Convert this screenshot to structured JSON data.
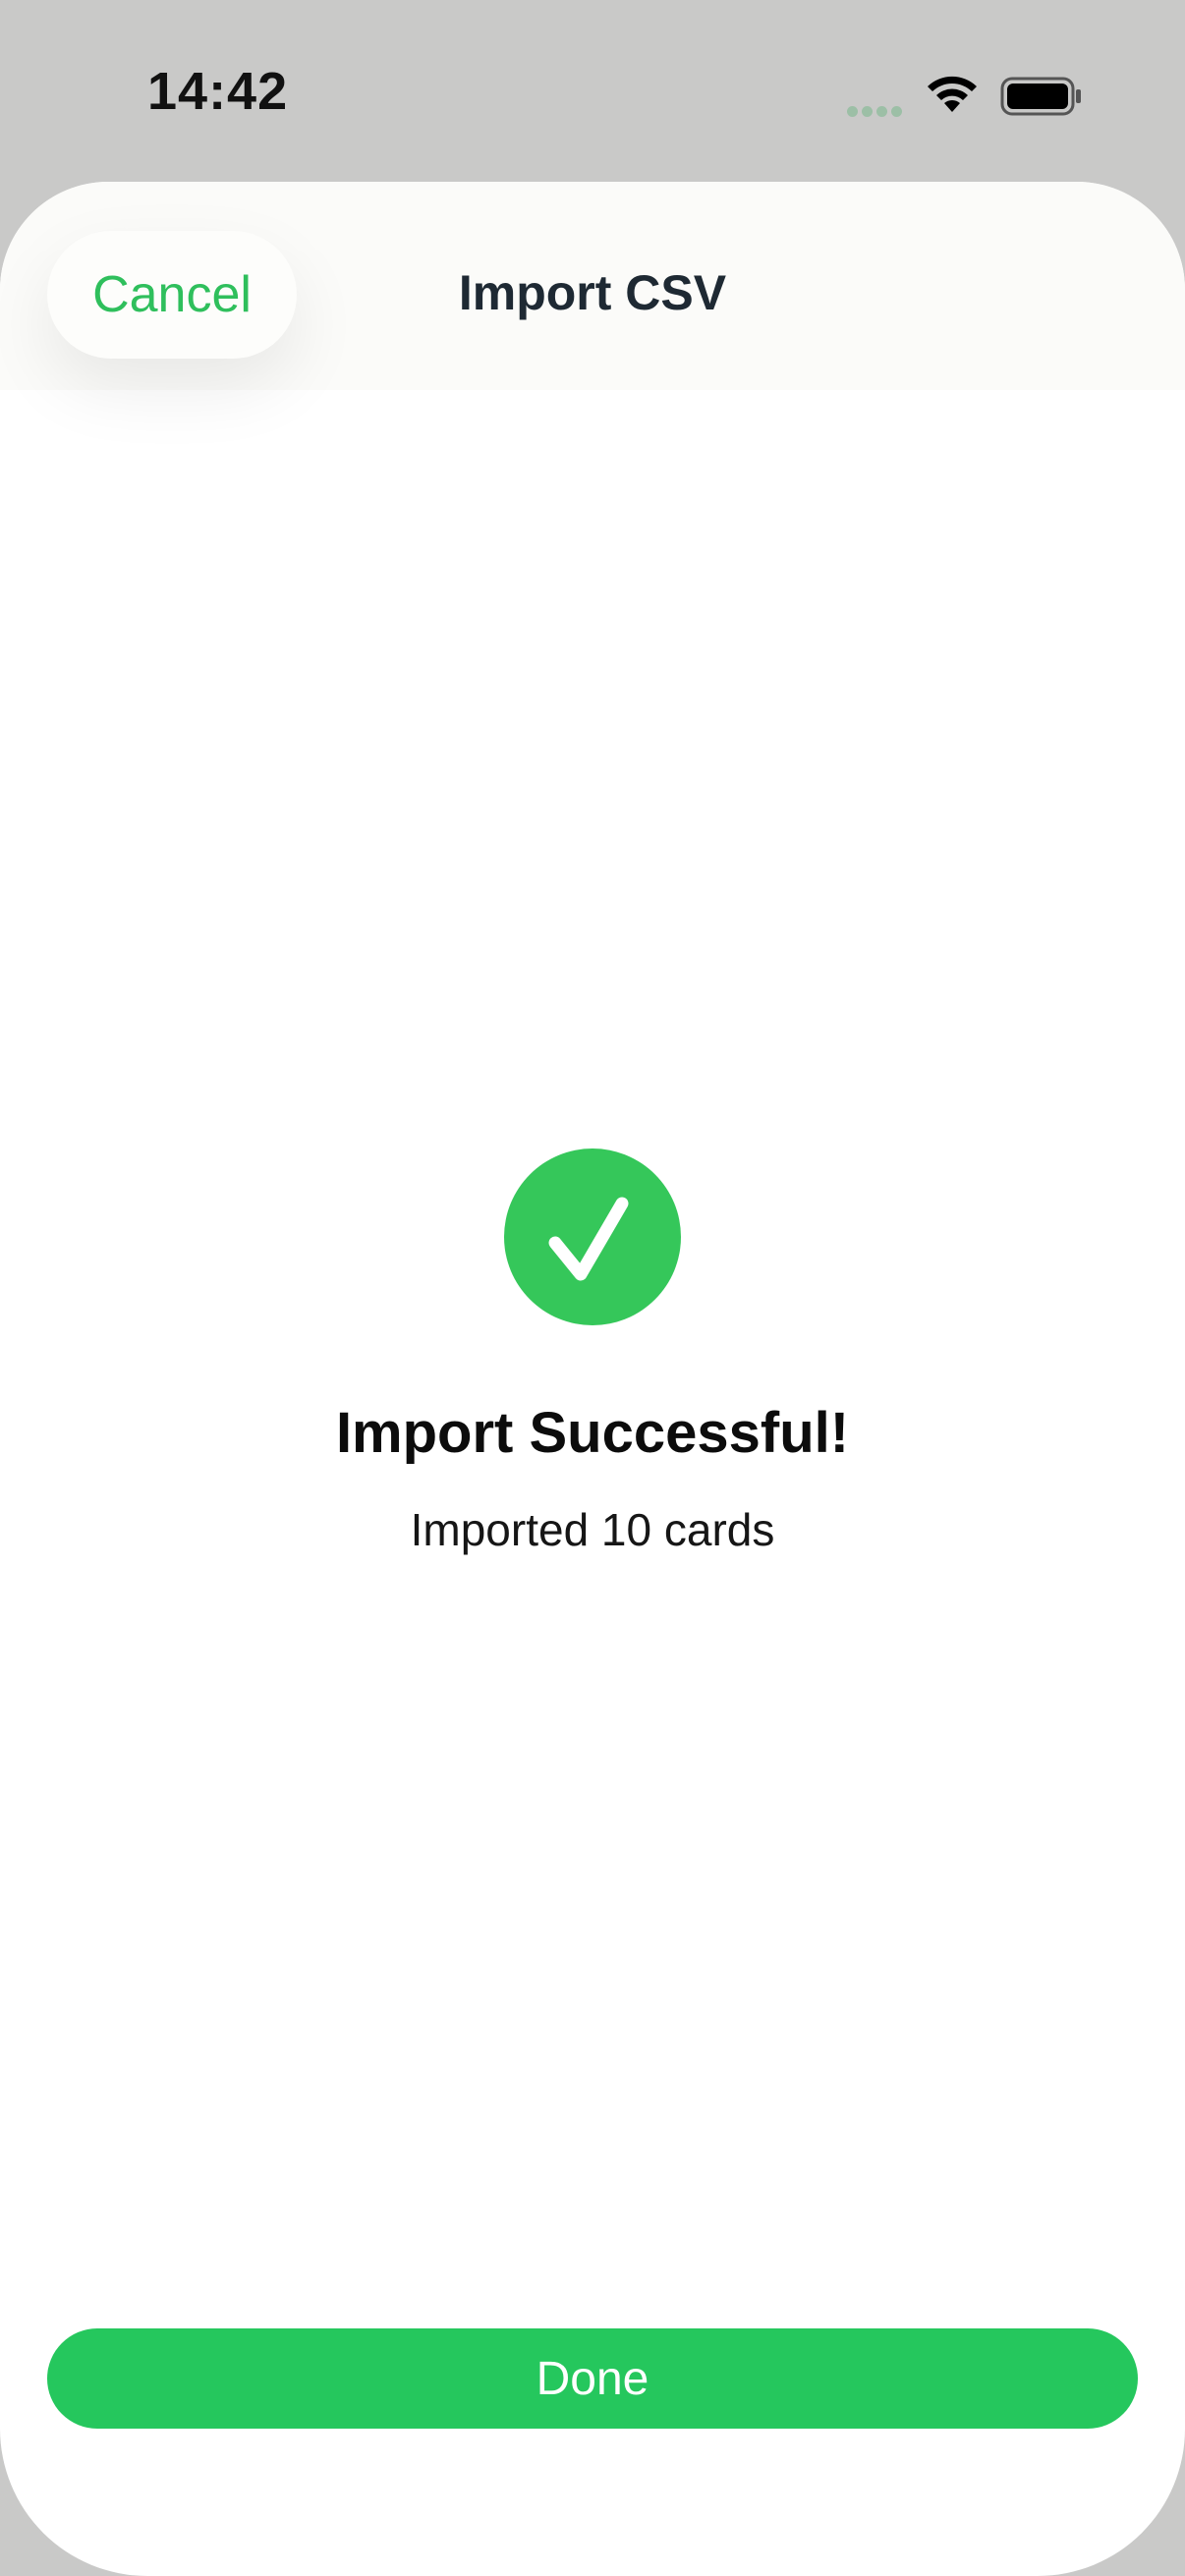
{
  "status_bar": {
    "time": "14:42",
    "wifi_icon": "wifi-icon",
    "battery_icon": "battery-icon"
  },
  "sheet": {
    "title": "Import CSV",
    "cancel_label": "Cancel"
  },
  "result": {
    "icon": "checkmark-circle-icon",
    "title": "Import Successful!",
    "subtitle": "Imported 10 cards"
  },
  "footer": {
    "done_label": "Done"
  },
  "colors": {
    "accent": "#25c75d",
    "success_icon": "#35c75a",
    "background": "#c9c9c8"
  }
}
